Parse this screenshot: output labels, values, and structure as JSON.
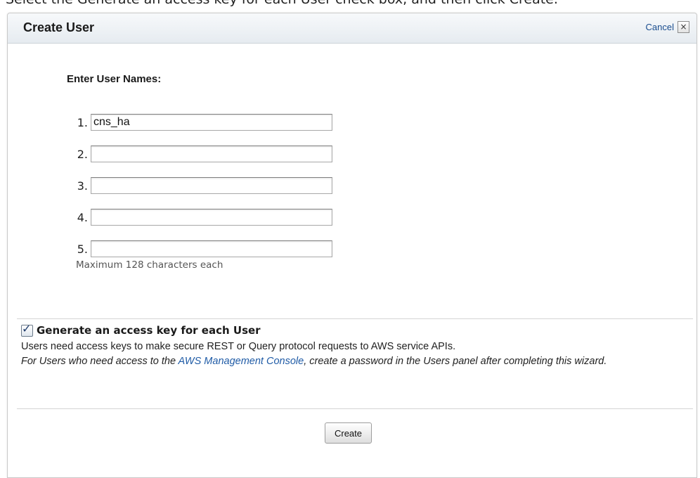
{
  "instruction_text": "Select the Generate an access key for each User check box, and then click Create.",
  "dialog": {
    "title": "Create User",
    "cancel_label": "Cancel",
    "cancel_icon": "×"
  },
  "user_names": {
    "heading": "Enter User Names:",
    "rows": [
      {
        "number": "1.",
        "value": "cns_ha"
      },
      {
        "number": "2.",
        "value": ""
      },
      {
        "number": "3.",
        "value": ""
      },
      {
        "number": "4.",
        "value": ""
      },
      {
        "number": "5.",
        "value": ""
      }
    ],
    "max_hint": "Maximum 128 characters each"
  },
  "access_key": {
    "checked": true,
    "checkmark": "✓",
    "label": "Generate an access key for each User",
    "description": "Users need access keys to make secure REST or Query protocol requests to AWS service APIs.",
    "note_prefix": "For Users who need access to the ",
    "note_link": "AWS Management Console",
    "note_suffix": ", create a password in the Users panel after completing this wizard."
  },
  "footer": {
    "create_label": "Create"
  },
  "colors": {
    "link": "#1f5ba6",
    "header_bg": "#e6ebf0"
  }
}
